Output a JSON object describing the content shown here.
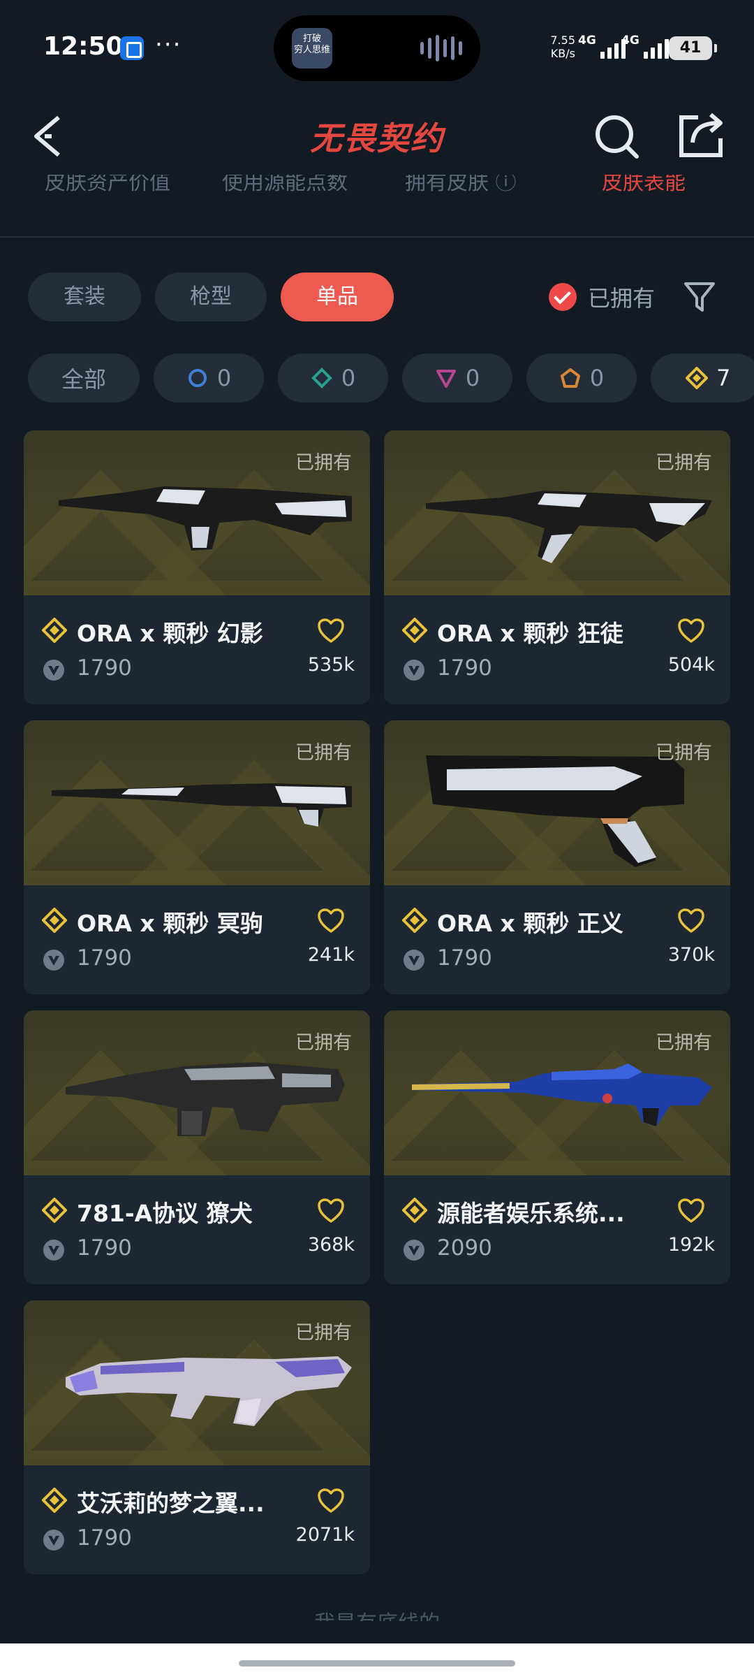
{
  "status_bar": {
    "time": "12:50",
    "more": "···",
    "island_thumb_text": "打破\n穷人思维",
    "net_speed_value": "7.55",
    "net_speed_unit": "KB/s",
    "sim1": "4G",
    "sim2": "4G",
    "battery": "41"
  },
  "header": {
    "logo": "无畏契约",
    "icons": [
      "back-icon",
      "search-icon",
      "share-icon"
    ]
  },
  "subtabs": {
    "items": [
      "皮肤资产价值",
      "使用源能点数",
      "拥有皮肤 ⓘ",
      "皮肤表能"
    ],
    "active_index": 3
  },
  "filters": {
    "type_tabs": [
      "套装",
      "枪型",
      "单品"
    ],
    "active_type": "单品",
    "owned_label": "已拥有",
    "owned_checked": true
  },
  "tiers": {
    "all_label": "全部",
    "items": [
      {
        "icon": "select-tier-icon",
        "color": "#3f7fd6",
        "count": "0"
      },
      {
        "icon": "deluxe-tier-icon",
        "color": "#27a38c",
        "count": "0"
      },
      {
        "icon": "premium-tier-icon",
        "color": "#b3468f",
        "count": "0"
      },
      {
        "icon": "exclusive-tier-icon",
        "color": "#d98636",
        "count": "0"
      },
      {
        "icon": "ultra-tier-icon",
        "color": "#e8c23a",
        "count": "7"
      }
    ]
  },
  "skins": [
    {
      "name": "ORA x 颗秒 幻影",
      "price": "1790",
      "likes": "535k",
      "badge": "已拥有"
    },
    {
      "name": "ORA x 颗秒 狂徒",
      "price": "1790",
      "likes": "504k",
      "badge": "已拥有"
    },
    {
      "name": "ORA x 颗秒 冥驹",
      "price": "1790",
      "likes": "241k",
      "badge": "已拥有"
    },
    {
      "name": "ORA x 颗秒 正义",
      "price": "1790",
      "likes": "370k",
      "badge": "已拥有"
    },
    {
      "name": "781-A协议 獠犬",
      "price": "1790",
      "likes": "368k",
      "badge": "已拥有"
    },
    {
      "name": "源能者娱乐系统...",
      "price": "2090",
      "likes": "192k",
      "badge": "已拥有"
    },
    {
      "name": "艾沃莉的梦之翼...",
      "price": "1790",
      "likes": "2071k",
      "badge": "已拥有"
    }
  ],
  "footer": {
    "text": "我是有底线的"
  },
  "colors": {
    "background": "#121b24",
    "accent": "#ee5a50",
    "gold": "#e8c23a"
  }
}
